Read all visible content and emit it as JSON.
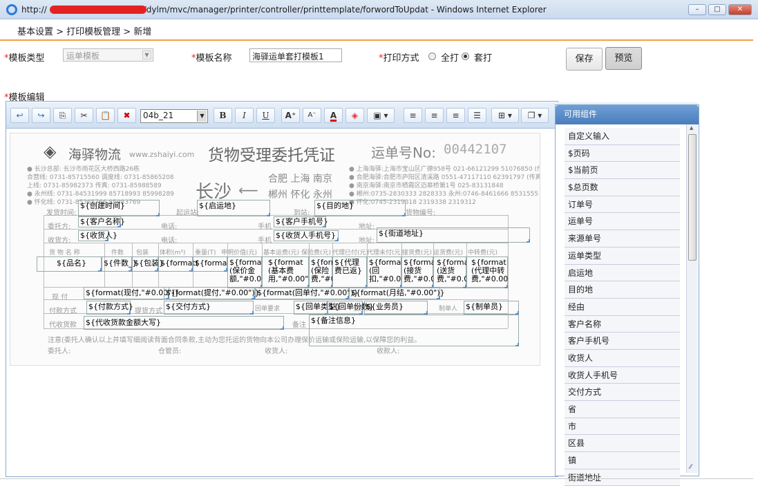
{
  "window": {
    "title": "http://",
    "title_rest": "/dylm/mvc/manager/printer/controller/printtemplate/forwordToUpdat - Windows Internet Explorer",
    "buttons": [
      "–",
      "□",
      "✕"
    ]
  },
  "breadcrumb": "基本设置 > 打印模板管理 > 新增",
  "form": {
    "type_label": "模板类型",
    "type_value": "运单模板",
    "name_label": "模板名称",
    "name_value": "海驿运单套打模板1",
    "print_label": "打印方式",
    "print_opt1": "全打",
    "print_opt2": "套打",
    "print_selected": "套打",
    "save": "保存",
    "preview": "预览",
    "edit_label": "模板编辑",
    "required_mark": "*"
  },
  "toolbar": {
    "font_value": "04b_21",
    "bold": "B",
    "italic": "I",
    "underline": "U",
    "grow": "A",
    "shrink": "A",
    "fontcolor": "A"
  },
  "doc": {
    "company": "海驿物流",
    "website": "www.zshaiyi.com",
    "title": "货物受理委托凭证",
    "waybill": "运单号No:",
    "waybill_no": "00442107",
    "cities_main": "长沙",
    "cities_row1": "合肥 上海 南京",
    "cities_row2": "郴州 怀化 永州",
    "labels": {
      "ship_time": "发货时间:",
      "origin": "起运站:",
      "dest": "到站:",
      "cargo_no": "货物编号:",
      "consignor": "委托方:",
      "tel": "电话:",
      "mobile": "手机",
      "addr": "地址:",
      "consignee": "收货方:",
      "goods": "货 物 名 称",
      "qty": "件数",
      "pack": "包装",
      "volume": "体积(m³)",
      "weight": "重量(T)",
      "declared": "申明价值(元)",
      "basefee": "基本运费(元)",
      "insure": "保险费(元)",
      "agent": "代理已付(元)",
      "agentpay": "代理未付(元)",
      "delivery": "接货费(元)",
      "transport": "运货费(元)",
      "transfer": "中转费(元)",
      "pay": "现 付",
      "paymethod": "付款方式",
      "pickup": "提货方式",
      "receipt": "回单要求",
      "salesman": "业务员",
      "maker": "制单人",
      "cod": "代收货款",
      "remark": "备注",
      "notice": "注意(委托人确认以上并填写细阅读背面合同条款,主动为您托运的货物向本公司办理保价运输或保险运输,以保障您的利益。",
      "signer": "委托人:",
      "warehouse": "仓管员:",
      "receiver": "收货人:",
      "collector": "收款人:"
    },
    "fields": {
      "ship_time": "${创建时间}",
      "origin": "${启运地}",
      "dest": "${目的地}",
      "consignor_name": "${客户名称}",
      "consignor_mobile": "${客户手机号}",
      "consignee_name": "${收货人}",
      "consignee_mobile": "${收货人手机号}",
      "street": "${街道地址}",
      "goods": "${品名}",
      "qty": "${件数_}",
      "pack": "${包装}",
      "vol": "${format(",
      "wt": "${forma",
      "declared": "${format (保价金额,\"#0.00\"",
      "basefee": "${format (基本费用,\"#0.00\")",
      "insure": "${form (保险费,\"#0",
      "agent": "${代理 费已返}",
      "agentpay": "${format (回扣,\"#0.0",
      "delivery": "${format (接货费,\"#0.0",
      "transport": "${format (送货费,\"#0.00",
      "transfer": "${format (代理中转费,\"#0.00",
      "pay_now": "${format(现付,\"#0.00\")}",
      "pay_pickup": "${format(提付,\"#0.00\")}",
      "pay_return": "${format(回单付,\"#0.00\")}",
      "pay_month": "${format(月结,\"#0.00\")}",
      "paymethod": "${付款方式}",
      "pickup": "${交付方式}",
      "receipt_type": "${回单类型}",
      "receipt_num": "${回单份数}",
      "salesman": "${业务员}",
      "maker": "${制单员}",
      "cod": "${代收货款金额大写}",
      "remark": "${备注信息}"
    }
  },
  "panel": {
    "title": "可用组件",
    "items": [
      "自定义输入",
      "$页码",
      "$当前页",
      "$总页数",
      "订单号",
      "运单号",
      "来源单号",
      "运单类型",
      "启运地",
      "目的地",
      "经由",
      "客户名称",
      "客户手机号",
      "收货人",
      "收货人手机号",
      "交付方式",
      "省",
      "市",
      "区县",
      "镇",
      "街道地址"
    ]
  }
}
